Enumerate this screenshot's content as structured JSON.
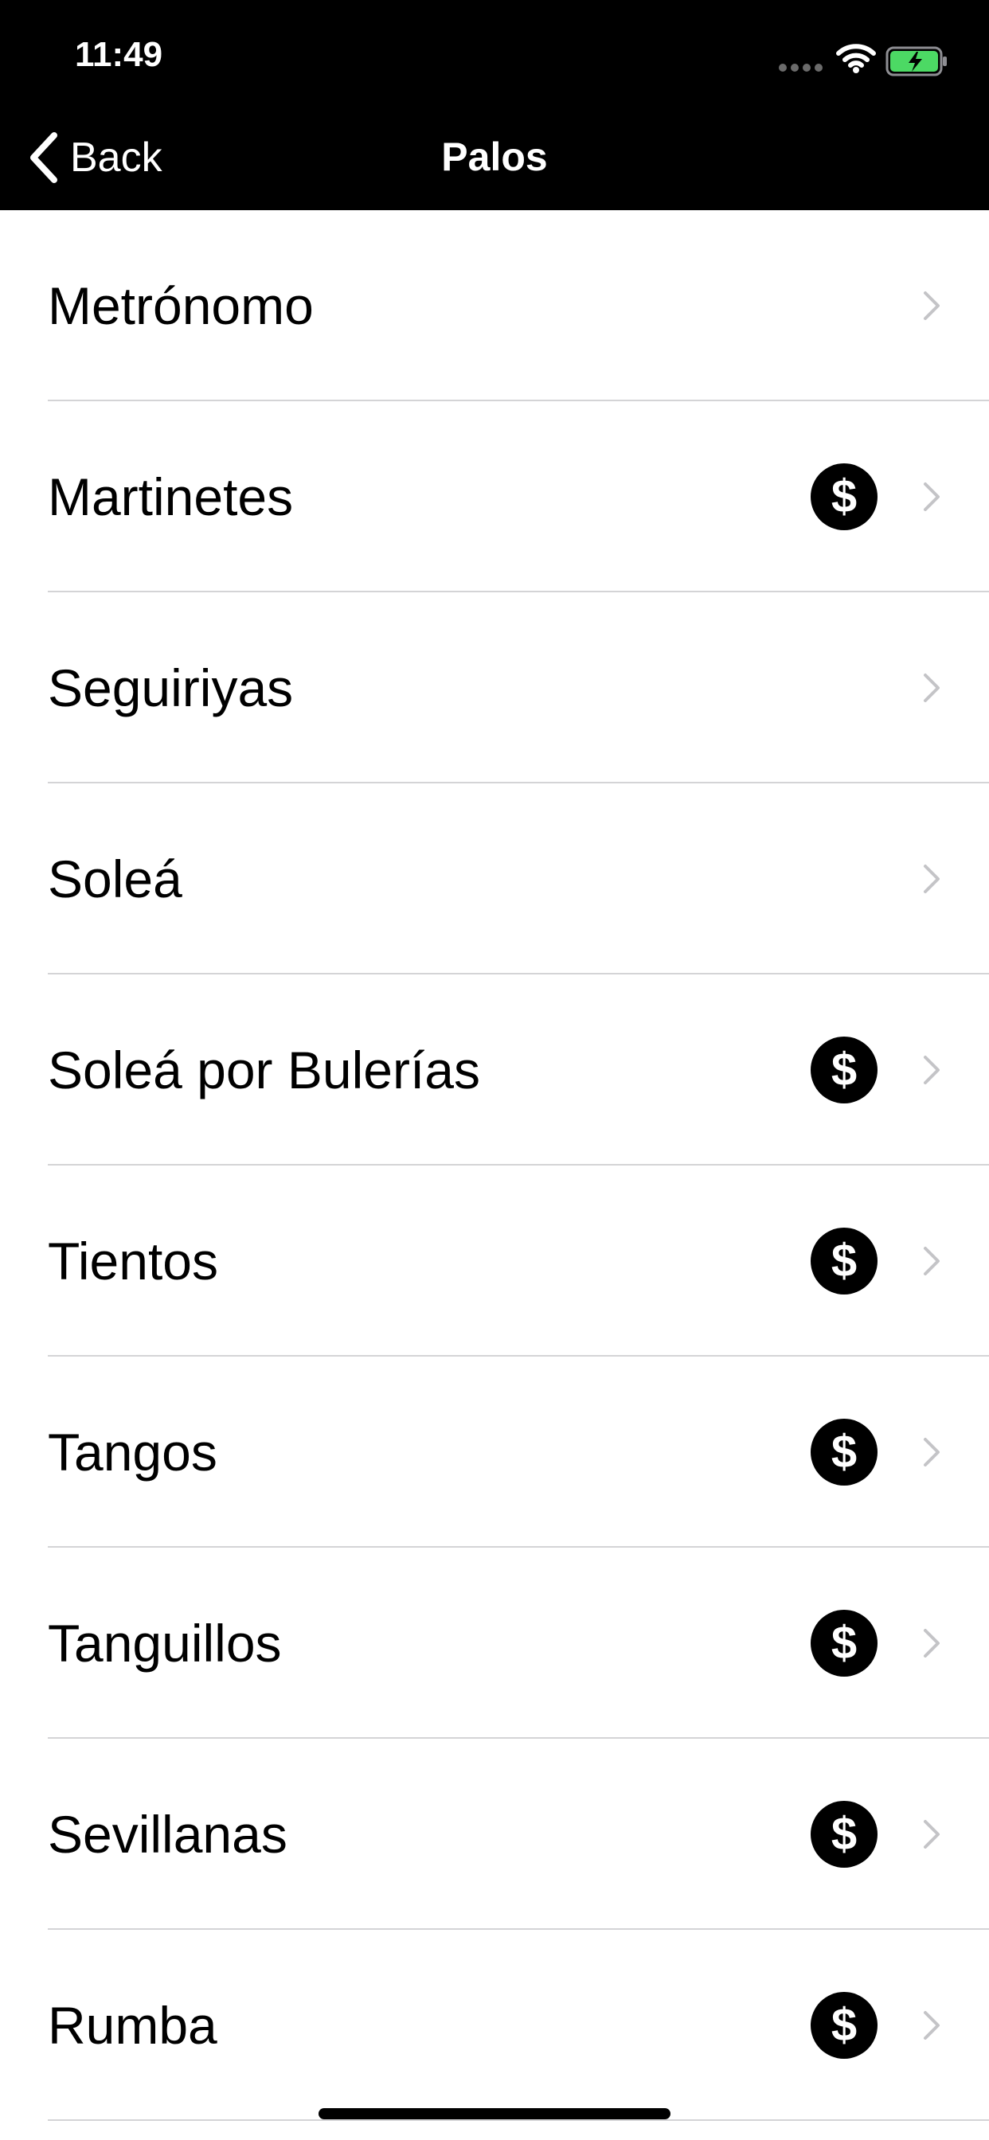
{
  "status_bar": {
    "time": "11:49"
  },
  "nav": {
    "back_label": "Back",
    "title": "Palos"
  },
  "items": [
    {
      "label": "Metrónomo",
      "paid": false
    },
    {
      "label": "Martinetes",
      "paid": true
    },
    {
      "label": "Seguiriyas",
      "paid": false
    },
    {
      "label": "Soleá",
      "paid": false
    },
    {
      "label": "Soleá por Bulerías",
      "paid": true
    },
    {
      "label": "Tientos",
      "paid": true
    },
    {
      "label": "Tangos",
      "paid": true
    },
    {
      "label": "Tanguillos",
      "paid": true
    },
    {
      "label": "Sevillanas",
      "paid": true
    },
    {
      "label": "Rumba",
      "paid": true
    }
  ],
  "icons": {
    "paid": "dollar-icon",
    "disclosure": "chevron-right-icon",
    "back": "chevron-left-icon"
  },
  "colors": {
    "header_bg": "#000000",
    "separator": "#d4d4d6",
    "chevron": "#c4c4c7",
    "battery": "#4cd964"
  }
}
